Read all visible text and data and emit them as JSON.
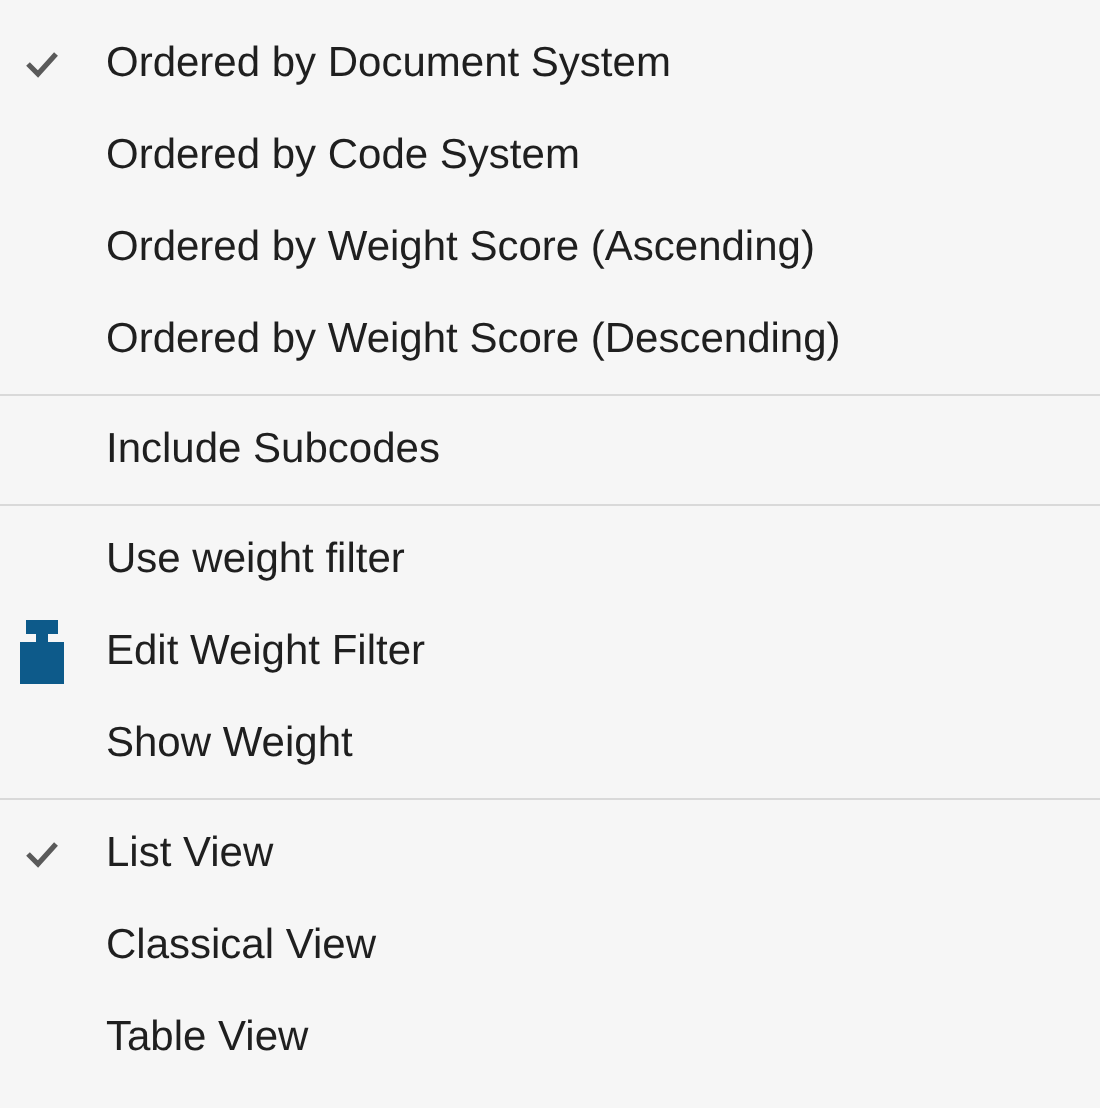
{
  "menu": {
    "groups": [
      {
        "items": [
          {
            "kind": "check",
            "label": "Ordered by Document System",
            "checked": true
          },
          {
            "kind": "check",
            "label": "Ordered by Code System",
            "checked": false
          },
          {
            "kind": "check",
            "label": "Ordered by Weight Score (Ascending)",
            "checked": false
          },
          {
            "kind": "check",
            "label": "Ordered by Weight Score (Descending)",
            "checked": false
          }
        ]
      },
      {
        "items": [
          {
            "kind": "check",
            "label": "Include Subcodes",
            "checked": false
          }
        ]
      },
      {
        "items": [
          {
            "kind": "check",
            "label": "Use weight filter",
            "checked": false
          },
          {
            "kind": "icon",
            "label": "Edit Weight Filter"
          },
          {
            "kind": "check",
            "label": "Show Weight",
            "checked": false
          }
        ]
      },
      {
        "items": [
          {
            "kind": "check",
            "label": "List View",
            "checked": true
          },
          {
            "kind": "check",
            "label": "Classical View",
            "checked": false
          },
          {
            "kind": "check",
            "label": "Table View",
            "checked": false
          }
        ]
      }
    ]
  }
}
